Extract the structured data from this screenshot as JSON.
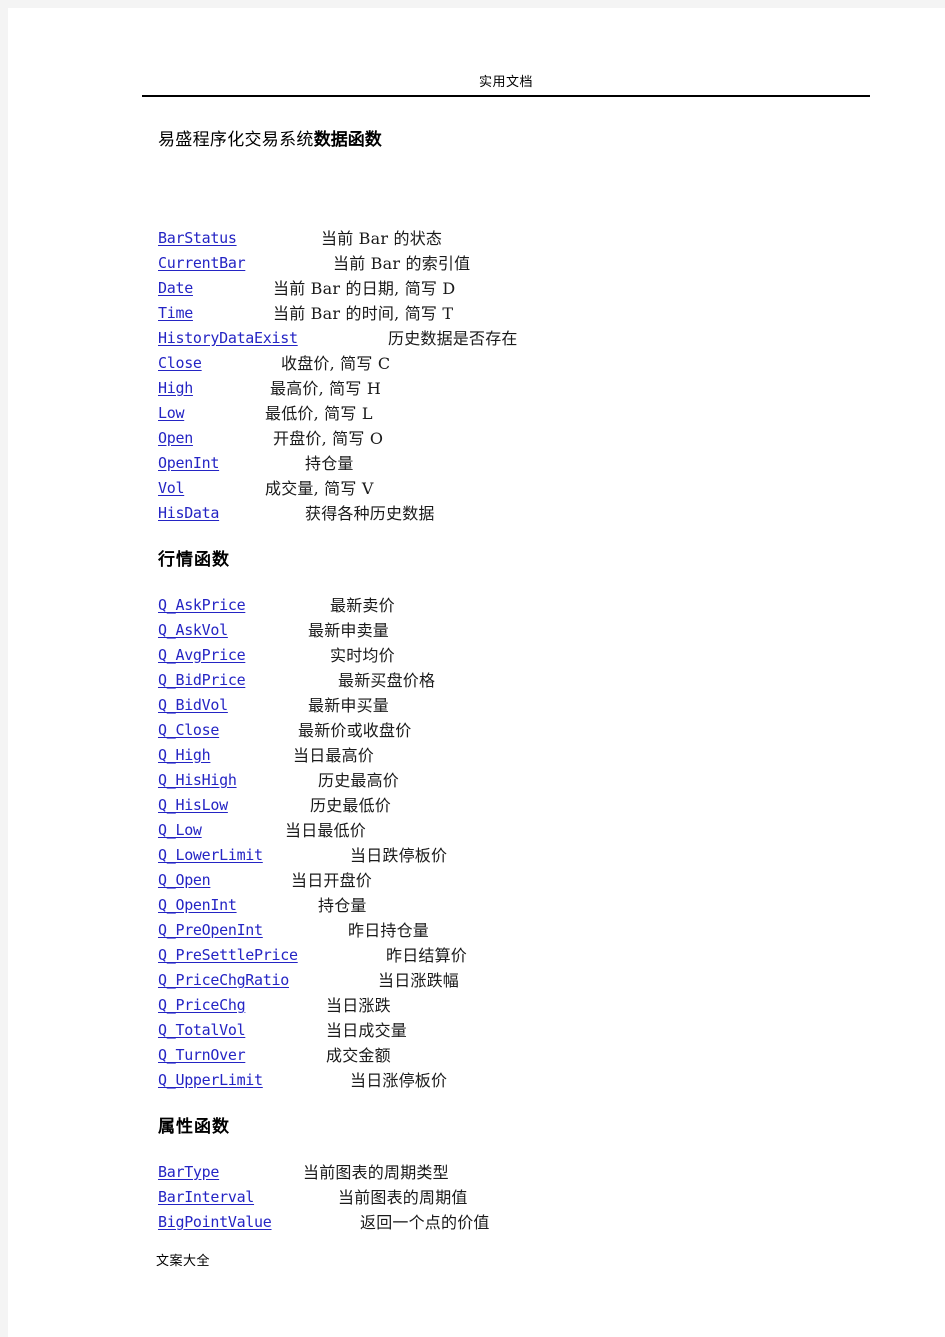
{
  "header": {
    "running_head": "实用文档"
  },
  "title": {
    "plain": "易盛程序化交易系统",
    "bold": "数据函数"
  },
  "footer": {
    "running_foot": "文案大全"
  },
  "sections": [
    {
      "heading": "",
      "rows": [
        {
          "name": "BarStatus",
          "desc": "当前 Bar 的状态",
          "indent": 163
        },
        {
          "name": "CurrentBar",
          "desc": "当前 Bar 的索引值",
          "indent": 175
        },
        {
          "name": "Date",
          "desc": "当前 Bar 的日期, 简写 D",
          "indent": 115
        },
        {
          "name": "Time",
          "desc": "当前 Bar 的时间, 简写 T",
          "indent": 115
        },
        {
          "name": "HistoryDataExist",
          "desc": "历史数据是否存在",
          "indent": 230
        },
        {
          "name": "Close",
          "desc": "收盘价, 简写 C",
          "indent": 123
        },
        {
          "name": "High",
          "desc": "最高价, 简写 H",
          "indent": 112
        },
        {
          "name": "Low",
          "desc": "最低价, 简写 L",
          "indent": 107
        },
        {
          "name": "Open",
          "desc": "开盘价, 简写 O",
          "indent": 115
        },
        {
          "name": "OpenInt",
          "desc": "持仓量",
          "indent": 147
        },
        {
          "name": "Vol",
          "desc": "成交量, 简写 V",
          "indent": 107
        },
        {
          "name": "HisData",
          "desc": "获得各种历史数据",
          "indent": 147
        }
      ]
    },
    {
      "heading": "行情函数",
      "rows": [
        {
          "name": "Q_AskPrice",
          "desc": "最新卖价",
          "indent": 172
        },
        {
          "name": "Q_AskVol",
          "desc": "最新申卖量",
          "indent": 150
        },
        {
          "name": "Q_AvgPrice",
          "desc": "实时均价",
          "indent": 172
        },
        {
          "name": "Q_BidPrice",
          "desc": "最新买盘价格",
          "indent": 180
        },
        {
          "name": "Q_BidVol",
          "desc": "最新申买量",
          "indent": 150
        },
        {
          "name": "Q_Close",
          "desc": "最新价或收盘价",
          "indent": 140
        },
        {
          "name": "Q_High",
          "desc": "当日最高价",
          "indent": 135
        },
        {
          "name": "Q_HisHigh",
          "desc": "历史最高价",
          "indent": 160
        },
        {
          "name": "Q_HisLow",
          "desc": "历史最低价",
          "indent": 152
        },
        {
          "name": "Q_Low",
          "desc": "当日最低价",
          "indent": 127
        },
        {
          "name": "Q_LowerLimit",
          "desc": "当日跌停板价",
          "indent": 192
        },
        {
          "name": "Q_Open",
          "desc": "当日开盘价",
          "indent": 133
        },
        {
          "name": "Q_OpenInt",
          "desc": "持仓量",
          "indent": 160
        },
        {
          "name": "Q_PreOpenInt",
          "desc": "昨日持仓量",
          "indent": 190
        },
        {
          "name": "Q_PreSettlePrice",
          "desc": "昨日结算价",
          "indent": 228
        },
        {
          "name": "Q_PriceChgRatio",
          "desc": "当日涨跌幅",
          "indent": 220
        },
        {
          "name": "Q_PriceChg",
          "desc": "当日涨跌",
          "indent": 168
        },
        {
          "name": "Q_TotalVol",
          "desc": "当日成交量",
          "indent": 168
        },
        {
          "name": "Q_TurnOver",
          "desc": "成交金额",
          "indent": 168
        },
        {
          "name": "Q_UpperLimit",
          "desc": "当日涨停板价",
          "indent": 192
        }
      ]
    },
    {
      "heading": "属性函数",
      "rows": [
        {
          "name": "BarType",
          "desc": "当前图表的周期类型",
          "indent": 145
        },
        {
          "name": "BarInterval",
          "desc": "当前图表的周期值",
          "indent": 180
        },
        {
          "name": "BigPointValue",
          "desc": "返回一个点的价值",
          "indent": 202
        }
      ]
    }
  ],
  "colors": {
    "link": "#2424c4",
    "text": "#1a1a1a",
    "page": "#ffffff",
    "canvas": "#f4f4f4",
    "rule": "#000000"
  }
}
